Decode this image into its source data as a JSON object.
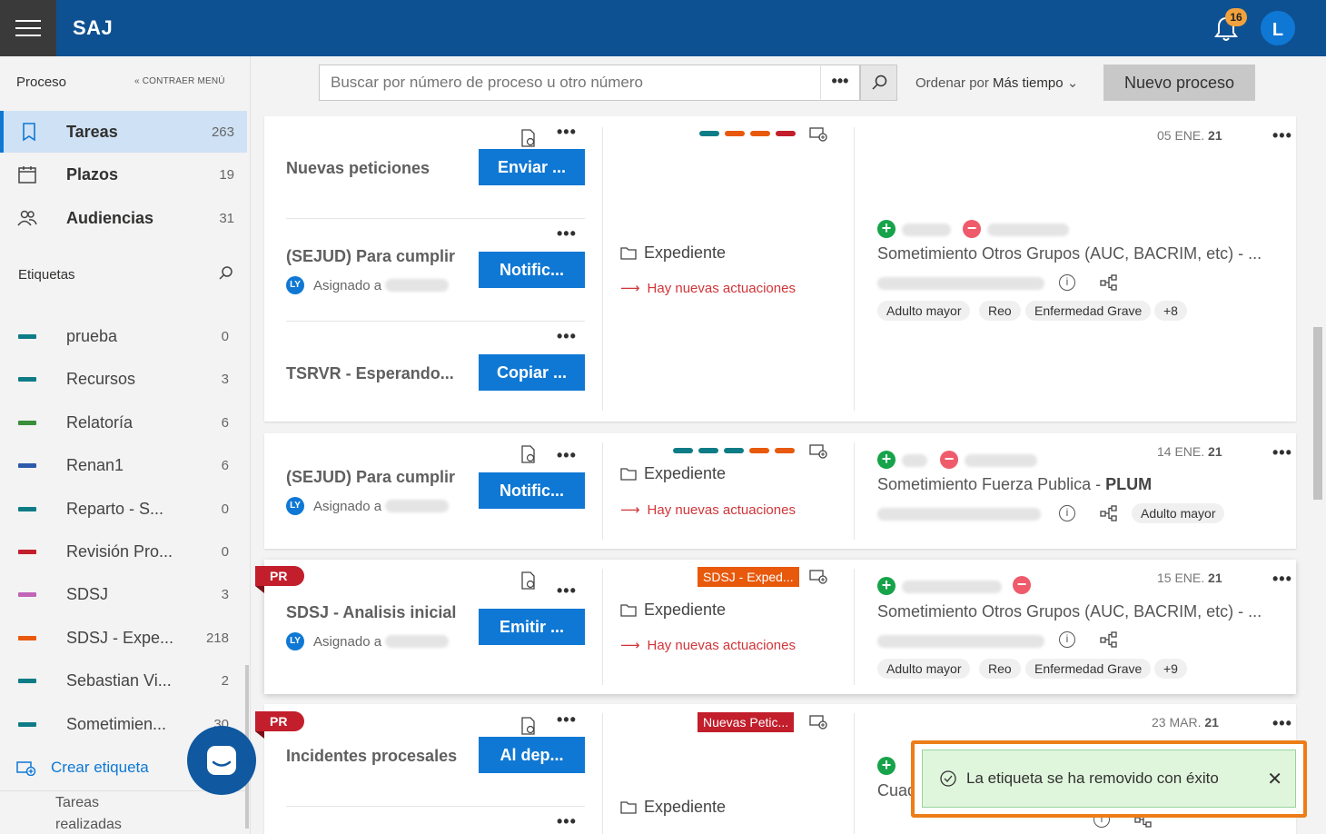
{
  "app": {
    "name": "SAJ",
    "notifications": "16",
    "user_initial": "L"
  },
  "sidebar": {
    "header": "Proceso",
    "collapse_label": "CONTRAER MENÚ",
    "nav": [
      {
        "label": "Tareas",
        "count": "263",
        "icon": "book-icon"
      },
      {
        "label": "Plazos",
        "count": "19",
        "icon": "calendar-icon"
      },
      {
        "label": "Audiencias",
        "count": "31",
        "icon": "people-icon"
      }
    ],
    "tags_header": "Etiquetas",
    "tags": [
      {
        "label": "prueba",
        "count": "0",
        "color": "#0e7c86"
      },
      {
        "label": "Recursos",
        "count": "3",
        "color": "#0e7c86"
      },
      {
        "label": "Relatoría",
        "count": "6",
        "color": "#3a8f3a"
      },
      {
        "label": "Renan1",
        "count": "6",
        "color": "#2e5aac"
      },
      {
        "label": "Reparto - S...",
        "count": "0",
        "color": "#0e7c86"
      },
      {
        "label": "Revisión Pro...",
        "count": "0",
        "color": "#c21e2b"
      },
      {
        "label": "SDSJ",
        "count": "3",
        "color": "#c264b8"
      },
      {
        "label": "SDSJ - Expe...",
        "count": "218",
        "color": "#e8590c"
      },
      {
        "label": "Sebastian Vi...",
        "count": "2",
        "color": "#0e7c86"
      },
      {
        "label": "Sometimien...",
        "count": "30",
        "color": "#0e7c86"
      }
    ],
    "create_tag": "Crear etiqueta",
    "done_tasks": "Tareas realizadas"
  },
  "toolbar": {
    "search_placeholder": "Buscar por número de proceso u otro número",
    "more": "•••",
    "sort_prefix": "Ordenar por",
    "sort_value": "Más tiempo",
    "new_button": "Nuevo proceso"
  },
  "cards": [
    {
      "tasks": [
        {
          "title": "Nuevas peticiones",
          "action": "Enviar ..."
        },
        {
          "title": "(SEJUD) Para cumplir",
          "assigned": "Asignado a",
          "action": "Notific..."
        },
        {
          "title": "TSRVR - Esperando...",
          "action": "Copiar ..."
        }
      ],
      "expediente": "Expediente",
      "nuevas": "Hay nuevas actuaciones",
      "date": "05 ENE.",
      "year": "21",
      "subject": "Sometimiento Otros Grupos (AUC, BACRIM, etc) - ...",
      "pills": [
        "Adulto mayor",
        "Reo",
        "Enfermedad Grave",
        "+8"
      ],
      "tag_colors": [
        "#0e7c86",
        "#e8590c",
        "#e8590c",
        "#c21e2b"
      ]
    },
    {
      "tasks": [
        {
          "title": "(SEJUD) Para cumplir",
          "assigned": "Asignado a",
          "action": "Notific..."
        }
      ],
      "expediente": "Expediente",
      "nuevas": "Hay nuevas actuaciones",
      "date": "14 ENE.",
      "year": "21",
      "subject": "Sometimiento Fuerza Publica - ",
      "subject_bold": "PLUM",
      "pills": [
        "Adulto mayor"
      ],
      "tag_colors": [
        "#0e7c86",
        "#0e7c86",
        "#0e7c86",
        "#e8590c",
        "#e8590c"
      ]
    },
    {
      "flag": "PR",
      "tasks": [
        {
          "title": "SDSJ - Analisis inicial",
          "assigned": "Asignado a",
          "action": "Emitir ..."
        }
      ],
      "chip": "SDSJ - Exped...",
      "chip_color": "#e8590c",
      "expediente": "Expediente",
      "nuevas": "Hay nuevas actuaciones",
      "date": "15 ENE.",
      "year": "21",
      "subject": "Sometimiento Otros Grupos (AUC, BACRIM, etc) - ...",
      "pills": [
        "Adulto mayor",
        "Reo",
        "Enfermedad Grave",
        "+9"
      ]
    },
    {
      "flag": "PR",
      "tasks": [
        {
          "title": "Incidentes procesales",
          "action": "Al dep..."
        }
      ],
      "chip": "Nuevas Petic...",
      "chip_color": "#c21e2b",
      "expediente": "Expediente",
      "date": "23 MAR.",
      "year": "21",
      "subject": "Cuad"
    }
  ],
  "toast": {
    "message": "La etiqueta se ha removido con éxito",
    "close": "✕"
  }
}
